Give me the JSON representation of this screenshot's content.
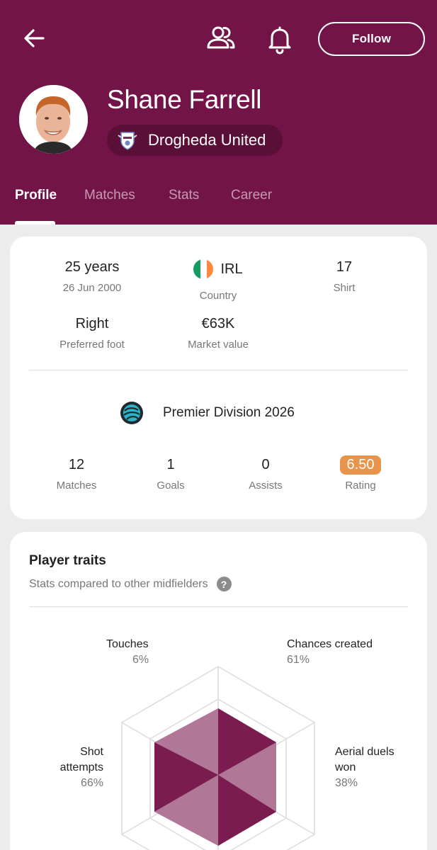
{
  "header": {
    "follow_label": "Follow",
    "player_name": "Shane Farrell",
    "team_name": "Drogheda United",
    "tabs": [
      "Profile",
      "Matches",
      "Stats",
      "Career"
    ],
    "active_tab": "Profile",
    "brand_color": "#721447"
  },
  "icons": {
    "back": "arrow-left-icon",
    "people": "people-icon",
    "bell": "bell-icon"
  },
  "bio": {
    "age_value": "25 years",
    "age_label": "26 Jun 2000",
    "country_value": "IRL",
    "country_label": "Country",
    "shirt_value": "17",
    "shirt_label": "Shirt",
    "foot_value": "Right",
    "foot_label": "Preferred foot",
    "market_value": "€63K",
    "market_label": "Market value"
  },
  "season": {
    "league_name": "Premier Division 2026",
    "stats": [
      {
        "value": "12",
        "label": "Matches"
      },
      {
        "value": "1",
        "label": "Goals"
      },
      {
        "value": "0",
        "label": "Assists"
      },
      {
        "value": "6.50",
        "label": "Rating"
      }
    ],
    "rating_color": "#e8944a"
  },
  "traits": {
    "title": "Player traits",
    "subtitle": "Stats compared to other midfielders",
    "help_symbol": "?",
    "items": [
      {
        "label": "Touches",
        "pct": "6%"
      },
      {
        "label": "Chances created",
        "pct": "61%"
      },
      {
        "label": "Shot attempts",
        "pct": "66%"
      },
      {
        "label": "Aerial duels won",
        "pct": "38%"
      }
    ]
  }
}
